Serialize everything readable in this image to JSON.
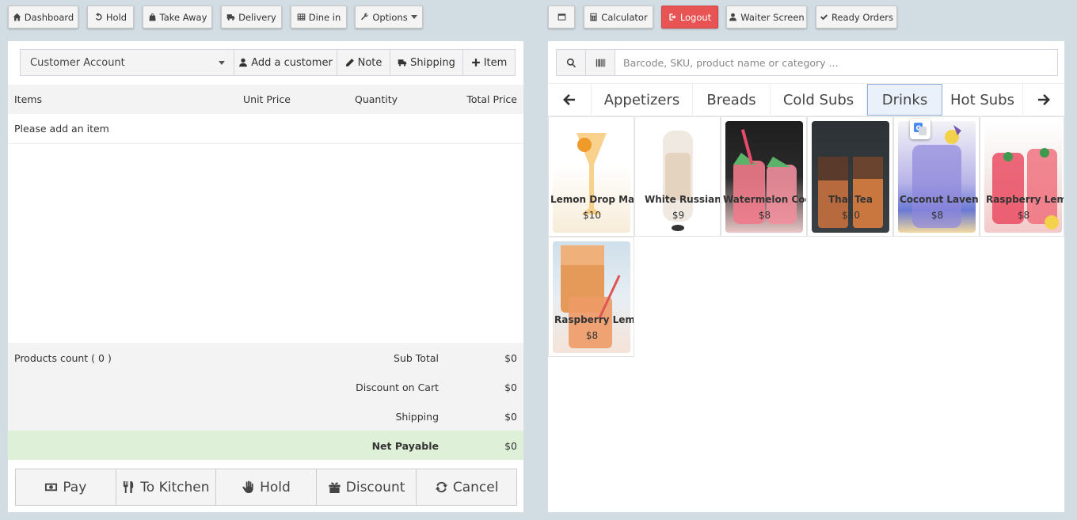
{
  "toolbar": {
    "dashboard": "Dashboard",
    "hold": "Hold",
    "take_away": "Take Away",
    "delivery": "Delivery",
    "dine_in": "Dine in",
    "options": "Options",
    "calculator": "Calculator",
    "logout": "Logout",
    "waiter_screen": "Waiter Screen",
    "ready_orders": "Ready Orders"
  },
  "customer": {
    "selected": "Customer Account",
    "add_customer": "Add a customer",
    "note": "Note",
    "shipping": "Shipping",
    "item": "Item"
  },
  "cart": {
    "columns": [
      "Items",
      "Unit Price",
      "Quantity",
      "Total Price"
    ],
    "empty_message": "Please add an item",
    "products_count": "Products count ( 0 )",
    "sub_total_label": "Sub Total",
    "sub_total": "$0",
    "discount_label": "Discount on Cart",
    "discount": "$0",
    "shipping_label": "Shipping",
    "shipping": "$0",
    "net_label": "Net Payable",
    "net": "$0"
  },
  "actions": {
    "pay": "Pay",
    "to_kitchen": "To Kitchen",
    "hold": "Hold",
    "discount": "Discount",
    "cancel": "Cancel"
  },
  "search": {
    "placeholder": "Barcode, SKU, product name or category ..."
  },
  "categories": [
    "Appetizers",
    "Breads",
    "Cold Subs",
    "Drinks",
    "Hot Subs"
  ],
  "active_category": "Drinks",
  "products": [
    {
      "name": "Lemon Drop Martini",
      "price": "$10"
    },
    {
      "name": "White Russian",
      "price": "$9"
    },
    {
      "name": "Watermelon Cooler",
      "price": "$8"
    },
    {
      "name": "Thai Tea",
      "price": "$10"
    },
    {
      "name": "Coconut Lavender Lemonade",
      "price": "$8"
    },
    {
      "name": "Raspberry Lemonade",
      "price": "$8"
    },
    {
      "name": "Raspberry Lemonade",
      "price": "$8"
    }
  ],
  "colors": {
    "background": "#d2dde3",
    "logout": "#e85454",
    "net_payable_bg": "#dff0d8",
    "active_tab_border": "#8fb1dd"
  }
}
